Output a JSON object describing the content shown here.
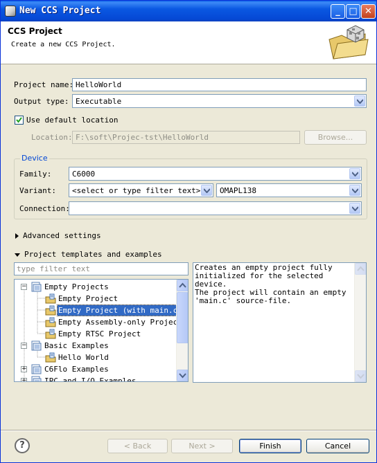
{
  "window": {
    "title": "New CCS Project",
    "controls": {
      "minimize": "_",
      "maximize": "□",
      "close": "✕"
    }
  },
  "banner": {
    "title": "CCS Project",
    "subtitle": "Create a new CCS Project."
  },
  "form": {
    "project_name_label": "Project name:",
    "project_name_value": "HelloWorld",
    "output_type_label": "Output type:",
    "output_type_value": "Executable",
    "use_default_location_label": "Use default location",
    "use_default_location_checked": true,
    "location_label": "Location:",
    "location_value": "F:\\soft\\Projec-tst\\HelloWorld",
    "browse_label": "Browse..."
  },
  "device": {
    "group_title": "Device",
    "family_label": "Family:",
    "family_value": "C6000",
    "variant_label": "Variant:",
    "variant_filter_value": "<select or type filter text>",
    "variant_value": "OMAPL138",
    "connection_label": "Connection:",
    "connection_value": ""
  },
  "advanced": {
    "label": "Advanced settings",
    "expanded": false
  },
  "templates": {
    "label": "Project templates and examples",
    "expanded": true,
    "filter_placeholder": "type filter text",
    "tree": [
      {
        "label": "Empty Projects",
        "level": 0,
        "expander": "−"
      },
      {
        "label": "Empty Project",
        "level": 1
      },
      {
        "label": "Empty Project (with main.c)",
        "level": 1,
        "selected": true
      },
      {
        "label": "Empty Assembly-only Project",
        "level": 1
      },
      {
        "label": "Empty RTSC Project",
        "level": 1
      },
      {
        "label": "Basic Examples",
        "level": 0,
        "expander": "−"
      },
      {
        "label": "Hello World",
        "level": 1
      },
      {
        "label": "C6Flo Examples",
        "level": 0,
        "expander": "+"
      },
      {
        "label": "IPC and I/O Examples",
        "level": 0,
        "expander": "+"
      }
    ],
    "description": "Creates an empty project fully\ninitialized for the selected device.\nThe project will contain an empty\n'main.c' source-file."
  },
  "footer": {
    "help_label": "?",
    "back_label": "< Back",
    "next_label": "Next >",
    "finish_label": "Finish",
    "cancel_label": "Cancel"
  },
  "colors": {
    "titlebar": "#0a58e2",
    "dialog_bg": "#ece9d8",
    "selection": "#316ac5",
    "group_title": "#0046d5"
  }
}
